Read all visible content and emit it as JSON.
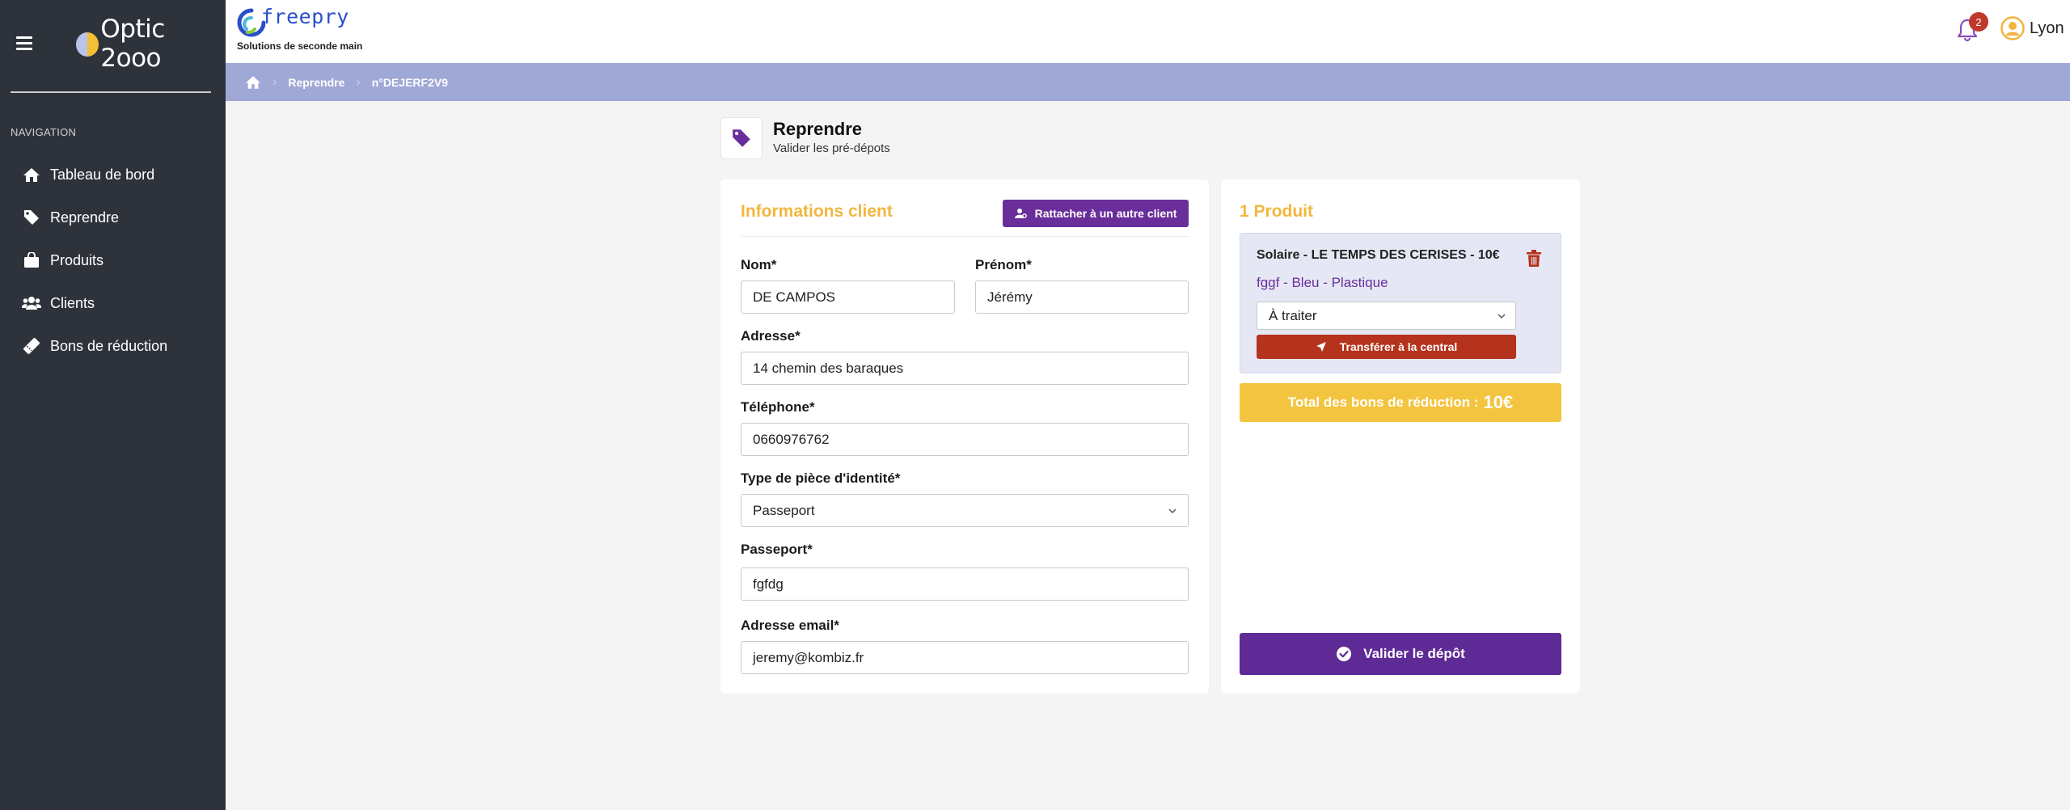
{
  "sidebar": {
    "brand": "Optic 2ooo",
    "section_label": "NAVIGATION",
    "items": [
      {
        "label": "Tableau de bord",
        "icon": "home-icon"
      },
      {
        "label": "Reprendre",
        "icon": "tag-icon"
      },
      {
        "label": "Produits",
        "icon": "shopping-bag-icon"
      },
      {
        "label": "Clients",
        "icon": "users-icon"
      },
      {
        "label": "Bons de réduction",
        "icon": "ticket-icon"
      }
    ]
  },
  "topbar": {
    "logo_name": "freepry",
    "logo_tagline": "Solutions de seconde main",
    "notification_count": "2",
    "user_name": "Lyon"
  },
  "breadcrumb": {
    "items": [
      "Reprendre",
      "n°DEJERF2V9"
    ]
  },
  "page": {
    "title": "Reprendre",
    "subtitle": "Valider les pré-dépots"
  },
  "client": {
    "title": "Informations client",
    "attach_button": "Rattacher à un autre client",
    "fields": {
      "nom": {
        "label": "Nom*",
        "value": "DE CAMPOS"
      },
      "prenom": {
        "label": "Prénom*",
        "value": "Jérémy"
      },
      "adresse": {
        "label": "Adresse*",
        "value": "14 chemin des baraques"
      },
      "telephone": {
        "label": "Téléphone*",
        "value": "0660976762"
      },
      "type_piece": {
        "label": "Type de pièce d'identité*",
        "value": "Passeport"
      },
      "passeport": {
        "label": "Passeport*",
        "value": "fgfdg"
      },
      "email": {
        "label": "Adresse email*",
        "value": "jeremy@kombiz.fr"
      }
    }
  },
  "products": {
    "title": "1 Produit",
    "item": {
      "name": "Solaire - LE TEMPS DES CERISES - 10€",
      "attributes": "fggf - Bleu - Plastique",
      "status": "À traiter",
      "transfer_button": "Transférer à la central"
    },
    "total_label": "Total des bons de réduction :",
    "total_value": "10€",
    "validate_button": "Valider le dépôt"
  },
  "colors": {
    "sidebar_bg": "#2e333b",
    "accent_purple": "#6a2e9b",
    "accent_yellow": "#f3c43f",
    "breadcrumb_bg": "#a0a8d6",
    "danger_red": "#b5321c"
  }
}
